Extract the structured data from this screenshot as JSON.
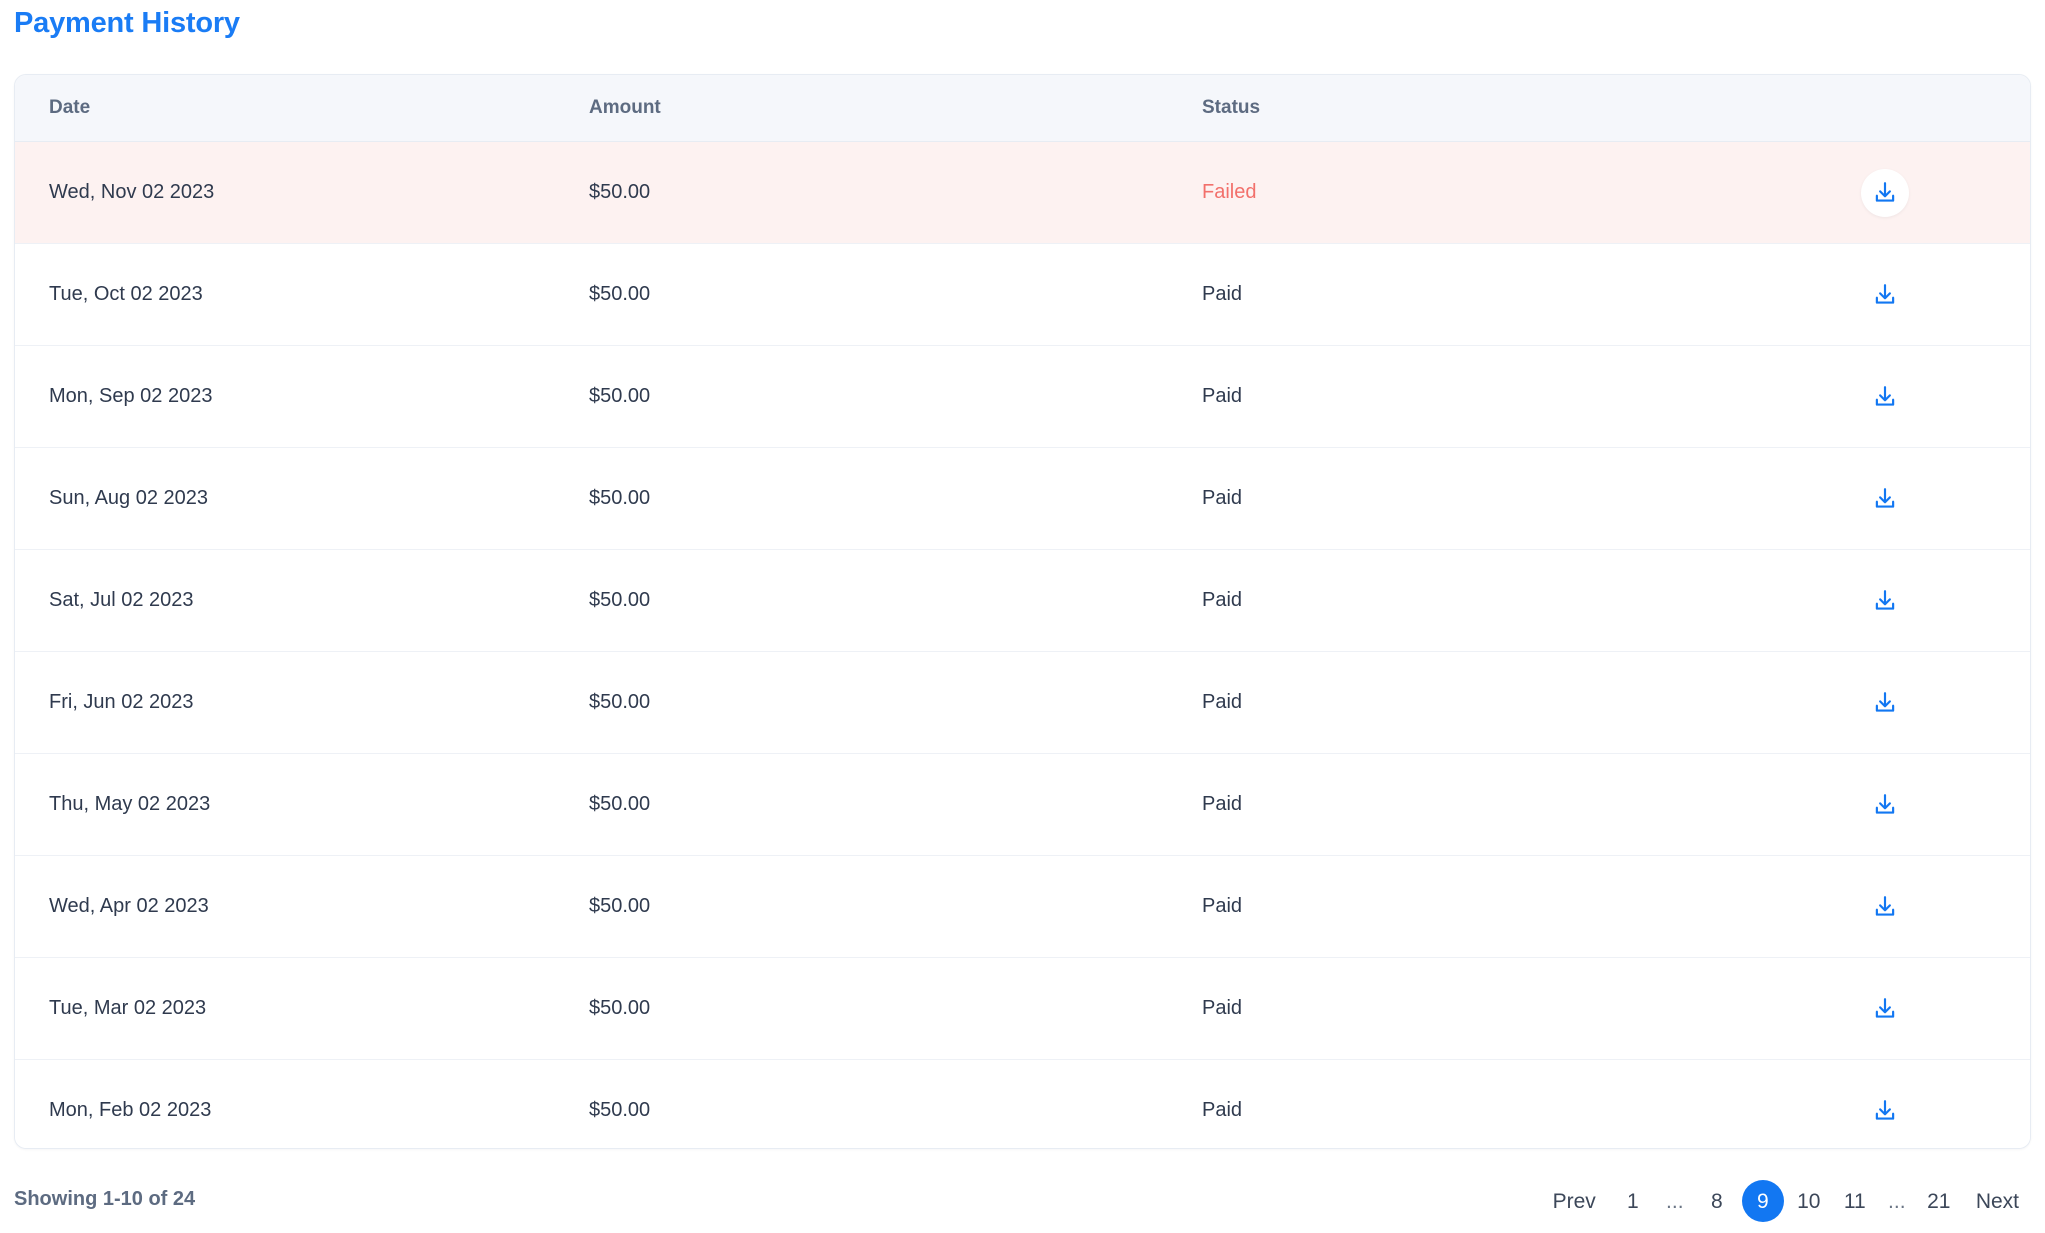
{
  "page_title": "Payment History",
  "colors": {
    "title_blue": "#1a7cf5",
    "accent_blue": "#1277f2",
    "failed_text": "#f2706b",
    "failed_row_bg": "#fdf2f1",
    "header_bg": "#f5f7fb",
    "body_text": "#2f3a4e",
    "muted_text": "#5d6b81"
  },
  "table": {
    "columns": [
      {
        "key": "date",
        "label": "Date"
      },
      {
        "key": "amount",
        "label": "Amount"
      },
      {
        "key": "status",
        "label": "Status"
      },
      {
        "key": "action",
        "label": ""
      }
    ],
    "rows": [
      {
        "date": "Wed, Nov 02 2023",
        "amount": "$50.00",
        "status": "Failed",
        "status_kind": "failed",
        "action_icon": "download-icon"
      },
      {
        "date": "Tue, Oct 02 2023",
        "amount": "$50.00",
        "status": "Paid",
        "status_kind": "paid",
        "action_icon": "download-icon"
      },
      {
        "date": "Mon, Sep 02 2023",
        "amount": "$50.00",
        "status": "Paid",
        "status_kind": "paid",
        "action_icon": "download-icon"
      },
      {
        "date": "Sun, Aug 02 2023",
        "amount": "$50.00",
        "status": "Paid",
        "status_kind": "paid",
        "action_icon": "download-icon"
      },
      {
        "date": "Sat, Jul 02 2023",
        "amount": "$50.00",
        "status": "Paid",
        "status_kind": "paid",
        "action_icon": "download-icon"
      },
      {
        "date": "Fri, Jun 02 2023",
        "amount": "$50.00",
        "status": "Paid",
        "status_kind": "paid",
        "action_icon": "download-icon"
      },
      {
        "date": "Thu, May 02 2023",
        "amount": "$50.00",
        "status": "Paid",
        "status_kind": "paid",
        "action_icon": "download-icon"
      },
      {
        "date": "Wed, Apr 02 2023",
        "amount": "$50.00",
        "status": "Paid",
        "status_kind": "paid",
        "action_icon": "download-icon"
      },
      {
        "date": "Tue, Mar 02 2023",
        "amount": "$50.00",
        "status": "Paid",
        "status_kind": "paid",
        "action_icon": "download-icon"
      },
      {
        "date": "Mon, Feb 02 2023",
        "amount": "$50.00",
        "status": "Paid",
        "status_kind": "paid",
        "action_icon": "download-icon"
      }
    ]
  },
  "footer": {
    "showing_text": "Showing 1-10 of 24",
    "pagination": {
      "prev_label": "Prev",
      "next_label": "Next",
      "current_page": "9",
      "items": [
        {
          "label": "1",
          "type": "page"
        },
        {
          "label": "...",
          "type": "ellipsis"
        },
        {
          "label": "8",
          "type": "page"
        },
        {
          "label": "9",
          "type": "page",
          "active": true
        },
        {
          "label": "10",
          "type": "page"
        },
        {
          "label": "11",
          "type": "page"
        },
        {
          "label": "...",
          "type": "ellipsis"
        },
        {
          "label": "21",
          "type": "page"
        }
      ]
    }
  }
}
